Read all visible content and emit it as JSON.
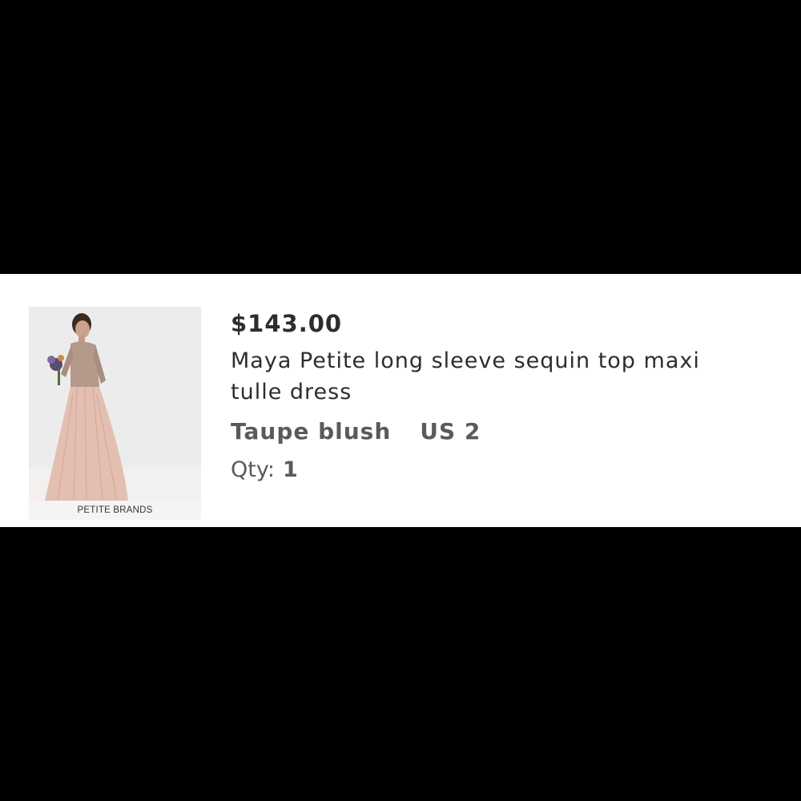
{
  "item": {
    "image_caption": "PETITE BRANDS",
    "price": "$143.00",
    "title": "Maya Petite long sleeve sequin top maxi tulle dress",
    "color": "Taupe blush",
    "size": "US 2",
    "qty_label": "Qty:",
    "qty_value": "1"
  },
  "colors": {
    "background": "#000000",
    "card": "#ffffff",
    "text_dark": "#2d2d2d",
    "text_muted": "#5a5a5a"
  }
}
